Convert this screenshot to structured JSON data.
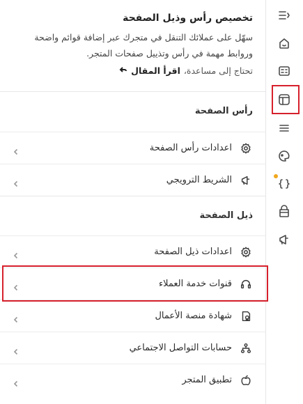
{
  "intro": {
    "title": "تخصيص رأس وذيل الصفحة",
    "description": "سهّل على عملائك التنقل في متجرك عبر إضافة قوائم واضحة وروابط مهمة في رأس وتذييل صفحات المتجر.",
    "help_text": "تحتاج إلى مساعدة،",
    "help_link": "اقرأ المقال"
  },
  "header_section": {
    "title": "رأس الصفحة",
    "items": [
      {
        "label": "اعدادات رأس الصفحة",
        "icon": "settings-icon"
      },
      {
        "label": "الشريط الترويجي",
        "icon": "megaphone-icon"
      }
    ]
  },
  "footer_section": {
    "title": "ذيل الصفحة",
    "items": [
      {
        "label": "اعدادات ذيل الصفحة",
        "icon": "settings-icon"
      },
      {
        "label": "قنوات خدمة العملاء",
        "icon": "headset-icon"
      },
      {
        "label": "شهادة منصة الأعمال",
        "icon": "certificate-icon"
      },
      {
        "label": "حسابات التواصل الاجتماعي",
        "icon": "network-icon"
      },
      {
        "label": "تطبيق المتجر",
        "icon": "apple-icon"
      }
    ]
  },
  "rail": {
    "icons": [
      "collapse-icon",
      "home-icon",
      "cards-icon",
      "layout-icon",
      "menu-icon",
      "theme-icon",
      "code-icon",
      "package-icon",
      "megaphone-icon"
    ],
    "active": "layout-icon"
  },
  "colors": {
    "highlight": "#d6202c",
    "badge": "#f0a81f"
  }
}
